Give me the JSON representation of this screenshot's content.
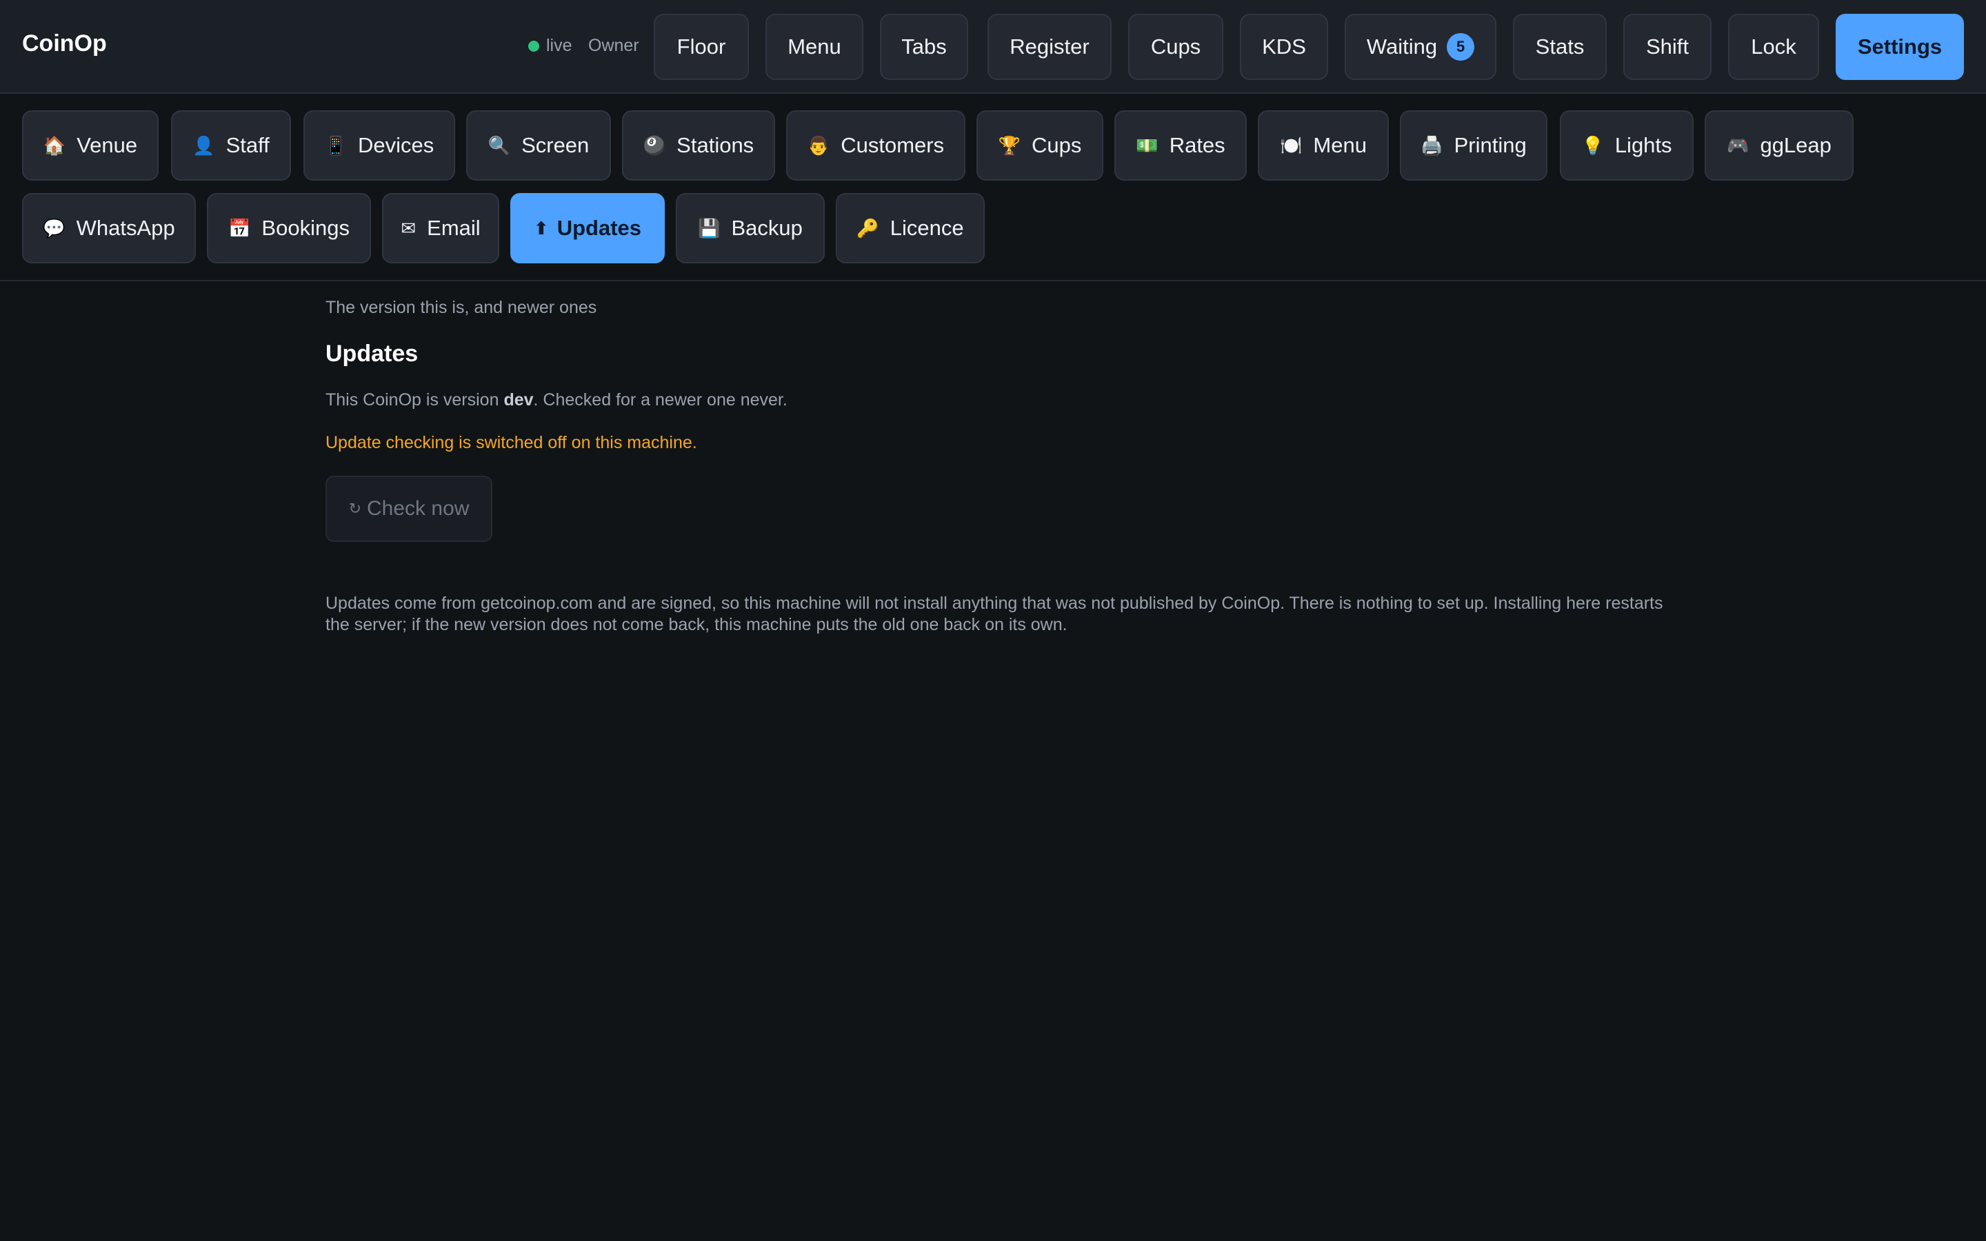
{
  "app": {
    "title": "CoinOp",
    "status": "live",
    "role": "Owner"
  },
  "topnav": {
    "floor": "Floor",
    "menu": "Menu",
    "tabs": "Tabs",
    "register": "Register",
    "cups": "Cups",
    "kds": "KDS",
    "waiting": "Waiting",
    "waiting_count": "5",
    "stats": "Stats",
    "shift": "Shift",
    "lock": "Lock",
    "settings": "Settings"
  },
  "settings_tabs": {
    "venue": "Venue",
    "staff": "Staff",
    "devices": "Devices",
    "screen": "Screen",
    "stations": "Stations",
    "customers": "Customers",
    "cups": "Cups",
    "rates": "Rates",
    "menu": "Menu",
    "printing": "Printing",
    "lights": "Lights",
    "ggleap": "ggLeap",
    "whatsapp": "WhatsApp",
    "bookings": "Bookings",
    "email": "Email",
    "updates": "Updates",
    "backup": "Backup",
    "licence": "Licence"
  },
  "icons": {
    "venue": "🏠",
    "staff": "👤",
    "devices": "📱",
    "screen": "🔍",
    "stations": "🎱",
    "customers": "👨",
    "cups": "🏆",
    "rates": "💵",
    "menu": "🍽️",
    "printing": "🖨️",
    "lights": "💡",
    "ggleap": "🎮",
    "whatsapp": "💬",
    "bookings": "📅",
    "email": "✉",
    "updates": "⬆",
    "backup": "💾",
    "licence": "🔑",
    "refresh": "↻"
  },
  "colors": {
    "accent": "#4ea1ff",
    "warning": "#f5a623",
    "live": "#2ec27e",
    "background": "#111417"
  },
  "updates": {
    "subtitle": "The version this is, and newer ones",
    "heading": "Updates",
    "version_prefix": "This CoinOp is version ",
    "version": "dev",
    "version_suffix": ". Checked for a newer one never.",
    "warning": "Update checking is switched off on this machine.",
    "check_button": "Check now",
    "note": "Updates come from getcoinop.com and are signed, so this machine will not install anything that was not published by CoinOp. There is nothing to set up. Installing here restarts the server; if the new version does not come back, this machine puts the old one back on its own."
  }
}
